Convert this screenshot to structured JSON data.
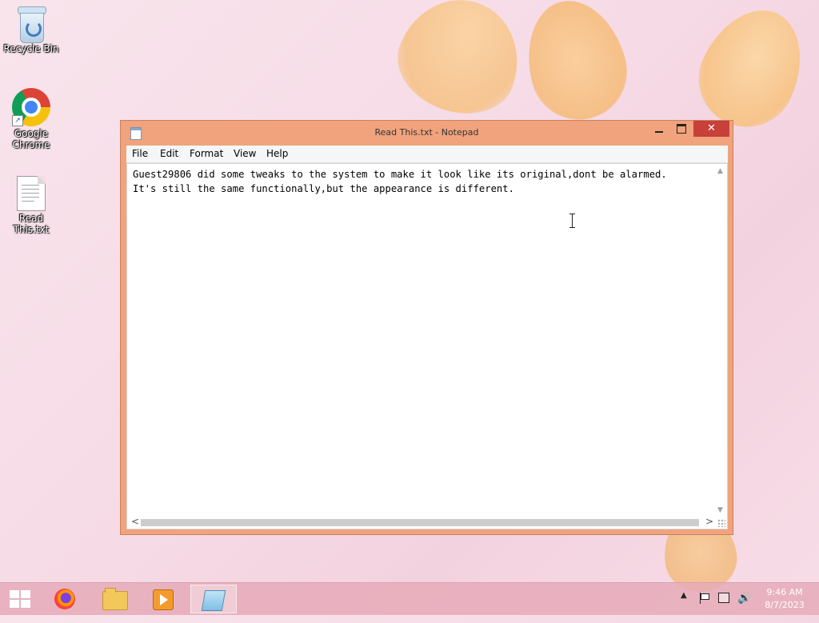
{
  "desktop": {
    "icons": [
      {
        "label": "Recycle Bin"
      },
      {
        "label": "Google Chrome"
      },
      {
        "label": "Read This.txt"
      }
    ]
  },
  "window": {
    "title": "Read This.txt - Notepad",
    "close_glyph": "✕",
    "menu": [
      "File",
      "Edit",
      "Format",
      "View",
      "Help"
    ],
    "content": "Guest29806 did some tweaks to the system to make it look like its original,dont be alarmed.\nIt's still the same functionally,but the appearance is different."
  },
  "scrollbar": {
    "up_glyph": "▲",
    "down_glyph": "▼",
    "left_glyph": "<",
    "right_glyph": ">"
  },
  "taskbar": {
    "apps": [
      {
        "name": "firefox-icon"
      },
      {
        "name": "file-explorer-icon"
      },
      {
        "name": "media-player-icon"
      },
      {
        "name": "notepad-icon",
        "active": true
      }
    ],
    "tray": {
      "show_hidden_glyph": "▲",
      "volume_glyph": "🔊"
    },
    "time": "9:46 AM",
    "date": "8/7/2023"
  },
  "colors": {
    "window_frame": "#f0a37c",
    "close_button": "#c7403a",
    "taskbar": "#e6aab9"
  }
}
